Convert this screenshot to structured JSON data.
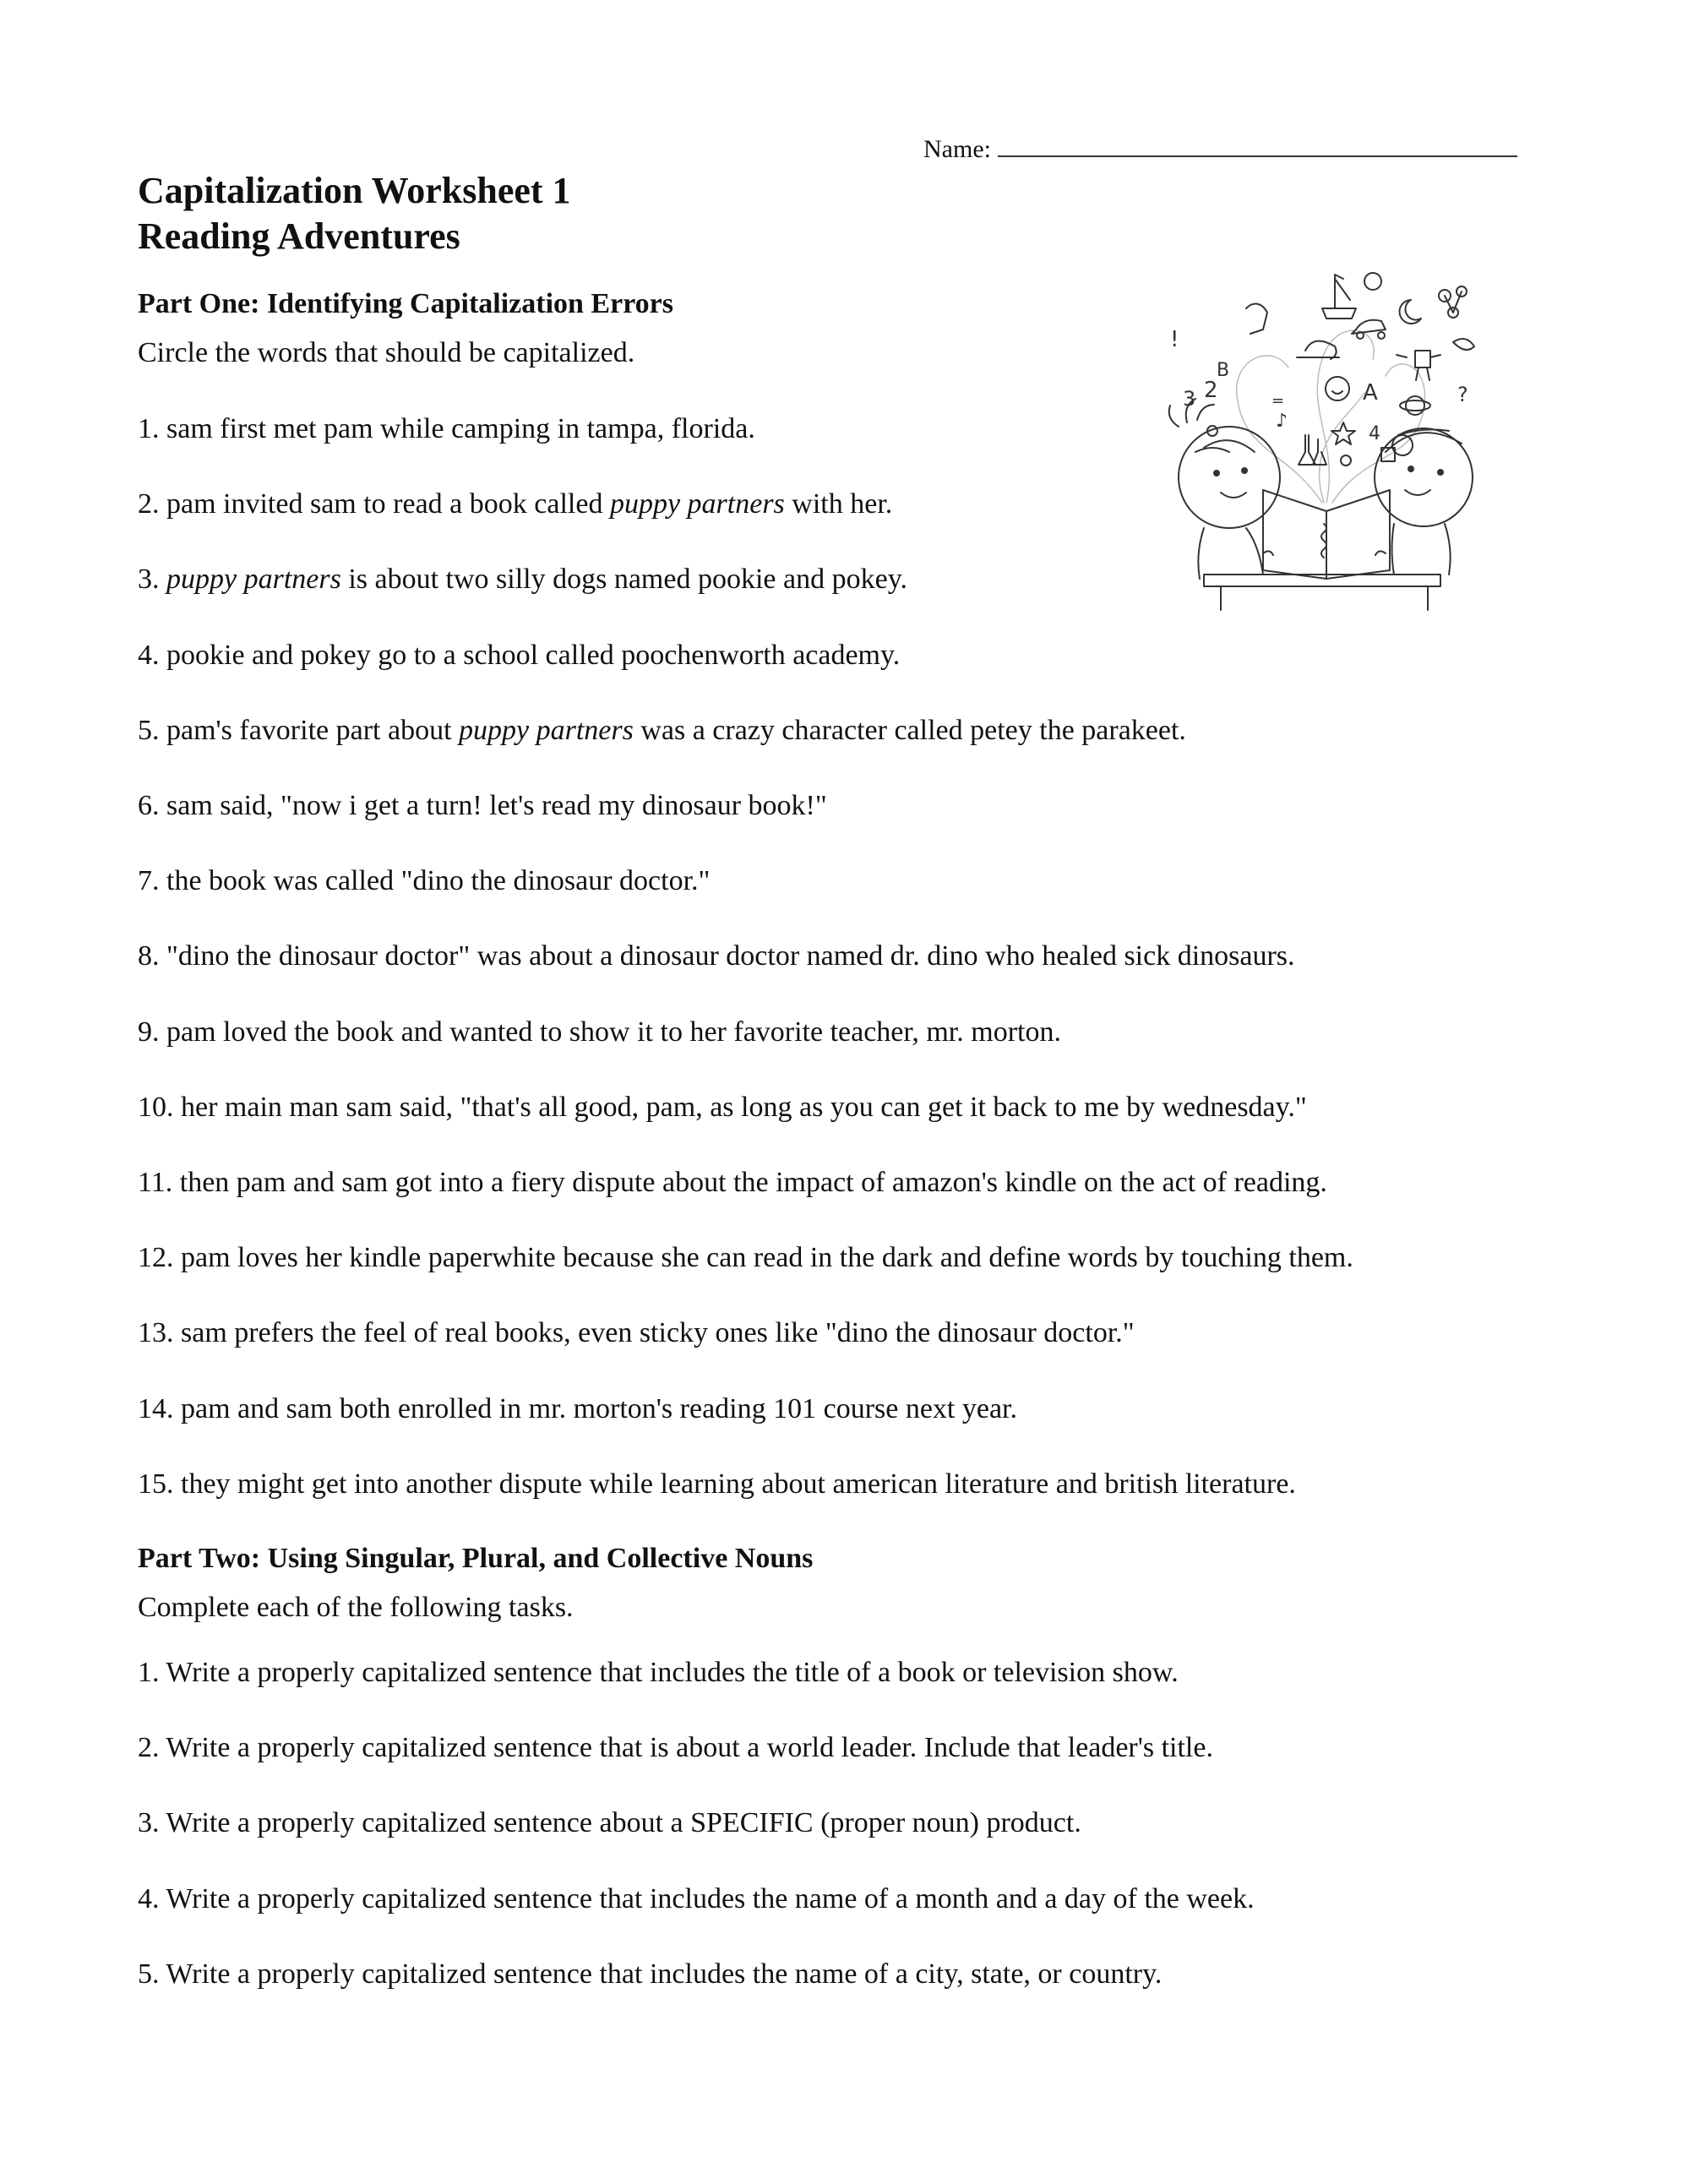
{
  "header": {
    "name_label": "Name:"
  },
  "title": "Capitalization Worksheet 1",
  "subtitle": "Reading Adventures",
  "illustration": {
    "icon": "children-reading-book-illustration"
  },
  "part_one": {
    "heading": "Part One: Identifying Capitalization Errors",
    "instruction": "Circle the words that should be capitalized.",
    "items": [
      {
        "num": "1.",
        "segments": [
          {
            "t": "sam first met pam while camping in tampa, florida."
          }
        ]
      },
      {
        "num": "2.",
        "segments": [
          {
            "t": "pam invited sam to read a book called "
          },
          {
            "t": "puppy partners",
            "i": true
          },
          {
            "t": " with her."
          }
        ]
      },
      {
        "num": "3.",
        "segments": [
          {
            "t": "puppy partners",
            "i": true
          },
          {
            "t": " is about two silly dogs named pookie and pokey."
          }
        ]
      },
      {
        "num": "4.",
        "segments": [
          {
            "t": "pookie and pokey go to a school called poochenworth academy."
          }
        ]
      },
      {
        "num": "5.",
        "segments": [
          {
            "t": "pam's favorite part about "
          },
          {
            "t": "puppy partners",
            "i": true
          },
          {
            "t": " was a crazy character called petey the parakeet."
          }
        ]
      },
      {
        "num": "6.",
        "segments": [
          {
            "t": "sam said, \"now i get a turn! let's read my dinosaur book!\""
          }
        ]
      },
      {
        "num": "7.",
        "segments": [
          {
            "t": "the book was called \"dino the dinosaur doctor.\""
          }
        ]
      },
      {
        "num": "8.",
        "segments": [
          {
            "t": "\"dino the dinosaur doctor\" was about a dinosaur doctor named dr. dino who healed sick dinosaurs."
          }
        ]
      },
      {
        "num": "9.",
        "segments": [
          {
            "t": "pam loved the book and wanted to show it to her favorite teacher, mr. morton."
          }
        ]
      },
      {
        "num": "10.",
        "segments": [
          {
            "t": "her main man sam said, \"that's all good, pam, as long as you can get it back to me by wednesday.\""
          }
        ]
      },
      {
        "num": "11.",
        "segments": [
          {
            "t": "then pam and sam got into a fiery dispute about the impact of amazon's kindle on the act of reading."
          }
        ]
      },
      {
        "num": "12.",
        "segments": [
          {
            "t": "pam loves her kindle paperwhite because she can read in the dark and define words by touching them."
          }
        ]
      },
      {
        "num": "13.",
        "segments": [
          {
            "t": "sam prefers the feel of real books, even sticky ones like \"dino the dinosaur doctor.\""
          }
        ]
      },
      {
        "num": "14.",
        "segments": [
          {
            "t": "pam and sam both enrolled in mr. morton's reading 101 course next year."
          }
        ]
      },
      {
        "num": "15.",
        "segments": [
          {
            "t": "they might get into another dispute while learning about american literature and british literature."
          }
        ]
      }
    ]
  },
  "part_two": {
    "heading": "Part Two: Using Singular, Plural, and Collective Nouns",
    "instruction": "Complete each of the following tasks.",
    "items": [
      {
        "num": "1.",
        "text": "Write a properly capitalized sentence that includes the title of a book or television show."
      },
      {
        "num": "2.",
        "text": "Write a properly capitalized sentence that is about a world leader. Include that leader's title."
      },
      {
        "num": "3.",
        "text": "Write a properly capitalized sentence about a SPECIFIC (proper noun) product."
      },
      {
        "num": "4.",
        "text": "Write a properly capitalized sentence that includes the name of a month and a day of the week."
      },
      {
        "num": "5.",
        "text": " Write a properly capitalized sentence that includes the name of a city, state, or country."
      }
    ]
  }
}
